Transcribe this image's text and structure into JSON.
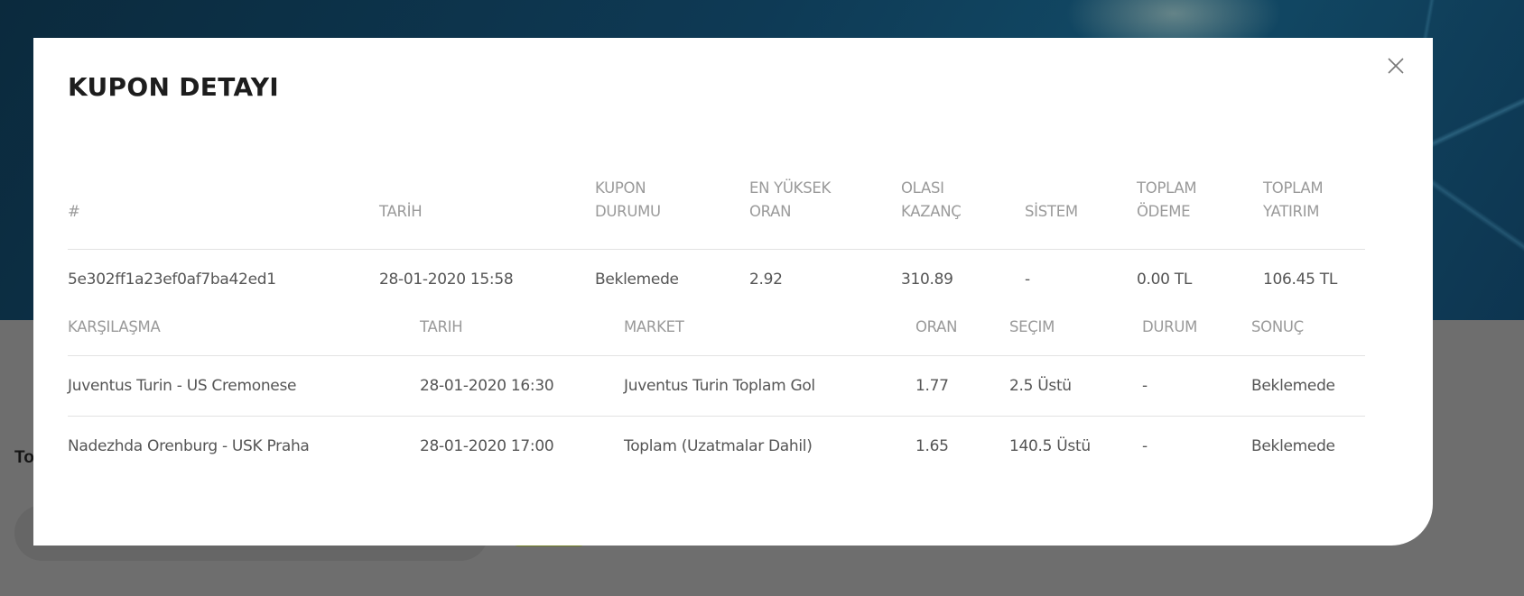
{
  "background": {
    "partial_text": "To"
  },
  "modal": {
    "title": "KUPON DETAYI",
    "close_icon": "close-icon"
  },
  "coupon_table": {
    "headers": {
      "id": "#",
      "date": "TARİH",
      "status_l1": "KUPON",
      "status_l2": "DURUMU",
      "max_odds_l1": "EN YÜKSEK",
      "max_odds_l2": "ORAN",
      "potential_l1": "OLASI",
      "potential_l2": "KAZANÇ",
      "system": "SİSTEM",
      "payout_l1": "TOPLAM",
      "payout_l2": "ÖDEME",
      "stake_l1": "TOPLAM",
      "stake_l2": "YATIRIM"
    },
    "row": {
      "id": "5e302ff1a23ef0af7ba42ed1",
      "date": "28-01-2020 15:58",
      "status": "Beklemede",
      "max_odds": "2.92",
      "potential": "310.89",
      "system": "-",
      "payout": "0.00 TL",
      "stake": "106.45 TL"
    }
  },
  "match_table": {
    "headers": {
      "match": "KARŞILAŞMA",
      "date": "TARIH",
      "market": "MARKET",
      "odds": "ORAN",
      "selection": "SEÇIM",
      "state": "DURUM",
      "result": "SONUÇ"
    },
    "rows": [
      {
        "match": "Juventus Turin - US Cremonese",
        "date": "28-01-2020 16:30",
        "market": "Juventus Turin Toplam Gol",
        "odds": "1.77",
        "selection": "2.5 Üstü",
        "state": "-",
        "result": "Beklemede"
      },
      {
        "match": "Nadezhda Orenburg - USK Praha",
        "date": "28-01-2020 17:00",
        "market": "Toplam (Uzatmalar Dahil)",
        "odds": "1.65",
        "selection": "140.5 Üstü",
        "state": "-",
        "result": "Beklemede"
      }
    ]
  }
}
